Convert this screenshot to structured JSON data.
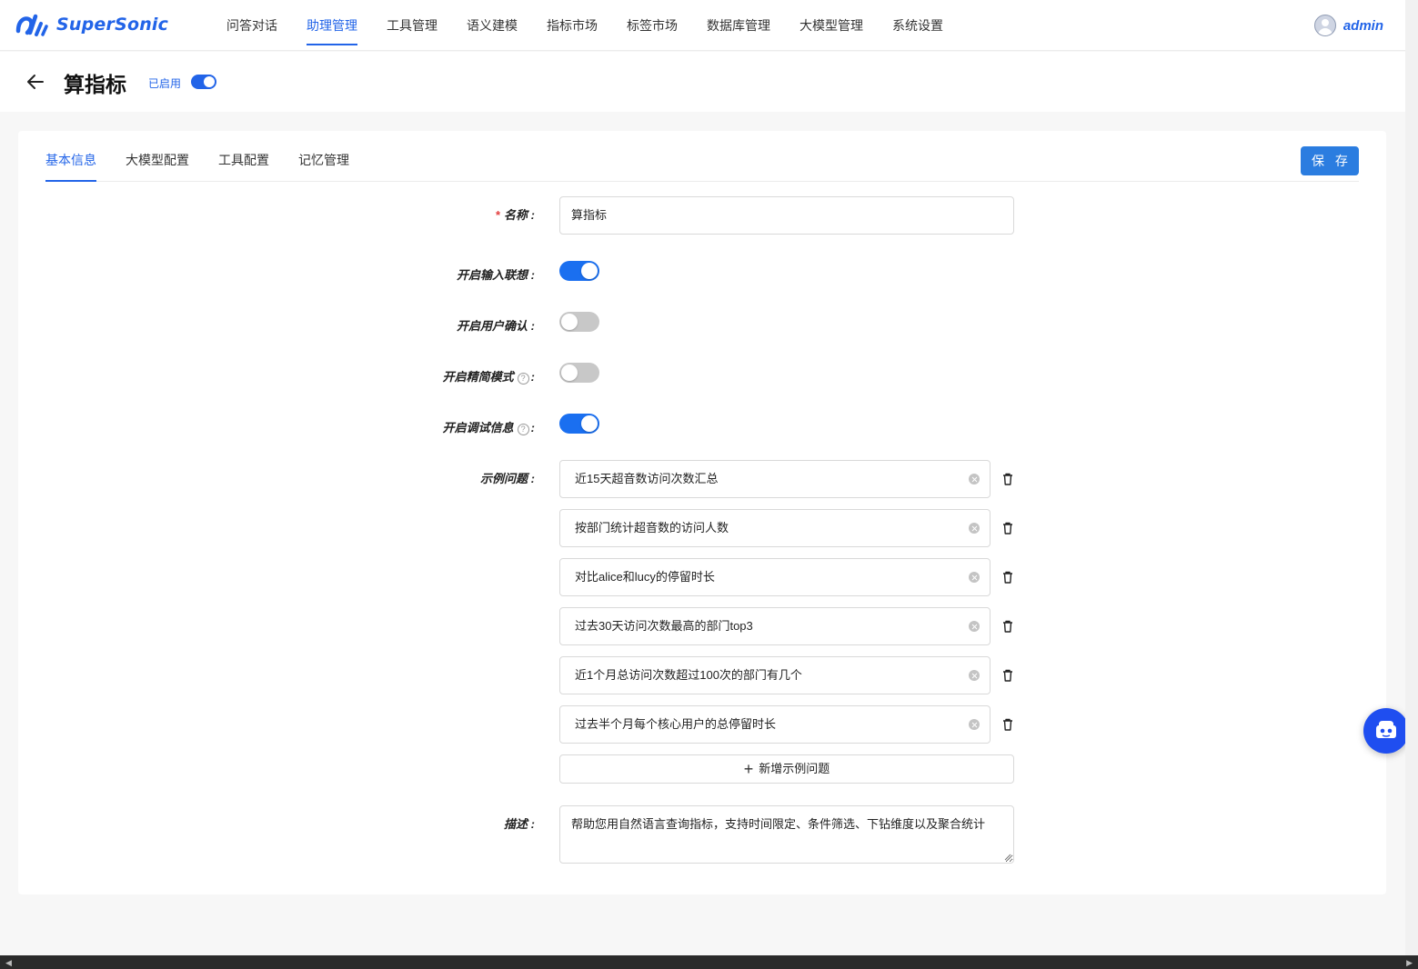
{
  "app": {
    "logo_text": "SuperSonic",
    "brand_color": "#2264e8"
  },
  "nav": {
    "items": [
      "问答对话",
      "助理管理",
      "工具管理",
      "语义建模",
      "指标市场",
      "标签市场",
      "数据库管理",
      "大模型管理",
      "系统设置"
    ],
    "active": "助理管理"
  },
  "user": {
    "name": "admin"
  },
  "header": {
    "title": "算指标",
    "status_label": "已启用",
    "enabled": true
  },
  "tabs": {
    "items": [
      "基本信息",
      "大模型配置",
      "工具配置",
      "记忆管理"
    ],
    "active": "基本信息"
  },
  "save_label": "保 存",
  "form": {
    "name_label": "名称",
    "name_value": "算指标",
    "input_suggest_label": "开启输入联想",
    "input_suggest_on": true,
    "user_confirm_label": "开启用户确认",
    "user_confirm_on": false,
    "simple_mode_label": "开启精简模式",
    "simple_mode_on": false,
    "debug_info_label": "开启调试信息",
    "debug_info_on": true,
    "examples_label": "示例问题",
    "examples": [
      "近15天超音数访问次数汇总",
      "按部门统计超音数的访问人数",
      "对比alice和lucy的停留时长",
      "过去30天访问次数最高的部门top3",
      "近1个月总访问次数超过100次的部门有几个",
      "过去半个月每个核心用户的总停留时长"
    ],
    "add_example_label": "新增示例问题",
    "desc_label": "描述",
    "desc_value": "帮助您用自然语言查询指标，支持时间限定、条件筛选、下钻维度以及聚合统计"
  }
}
